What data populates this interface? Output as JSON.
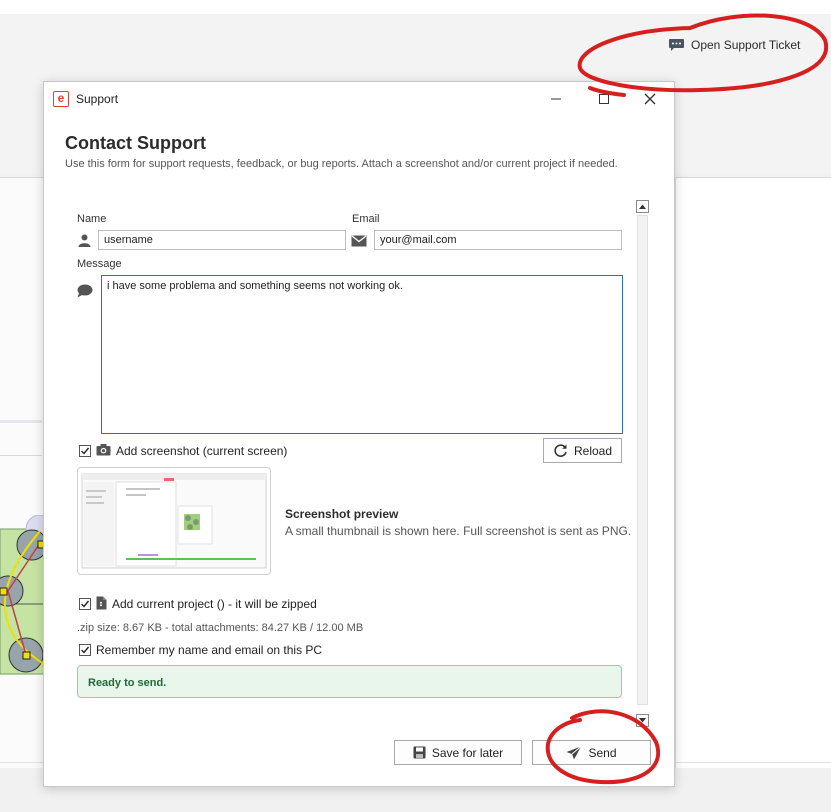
{
  "toolbar": {
    "open_ticket_label": "Open Support Ticket",
    "open_ticket_icon": "chat-ticket-icon"
  },
  "dialog": {
    "title": "Support",
    "app_icon_letter": "e",
    "heading": "Contact Support",
    "description": "Use this form for support requests, feedback, or bug reports. Attach a screenshot and/or current project if needed.",
    "name_label": "Name",
    "name_value": "username",
    "email_label": "Email",
    "email_value": "your@mail.com",
    "message_label": "Message",
    "message_value": "i have some problema and something seems not working ok.",
    "screenshot": {
      "checked": true,
      "label": "Add screenshot (current screen)",
      "reload_label": "Reload",
      "preview_title": "Screenshot preview",
      "preview_desc": "A small thumbnail is shown here. Full screenshot is sent as PNG."
    },
    "project": {
      "checked": true,
      "label": "Add current project () - it will be zipped",
      "zip_info": ".zip size: 8.67 KB - total attachments: 84.27 KB / 12.00 MB"
    },
    "remember": {
      "checked": true,
      "label": "Remember my name and email on this PC"
    },
    "status_text": "Ready to send.",
    "save_label": "Save for later",
    "send_label": "Send"
  },
  "colors": {
    "accent": "#2e6fb8",
    "status_bg": "#e8f6ec",
    "status_border": "#8fd1a2",
    "status_text": "#1f6b33",
    "annotation": "#d62020"
  }
}
